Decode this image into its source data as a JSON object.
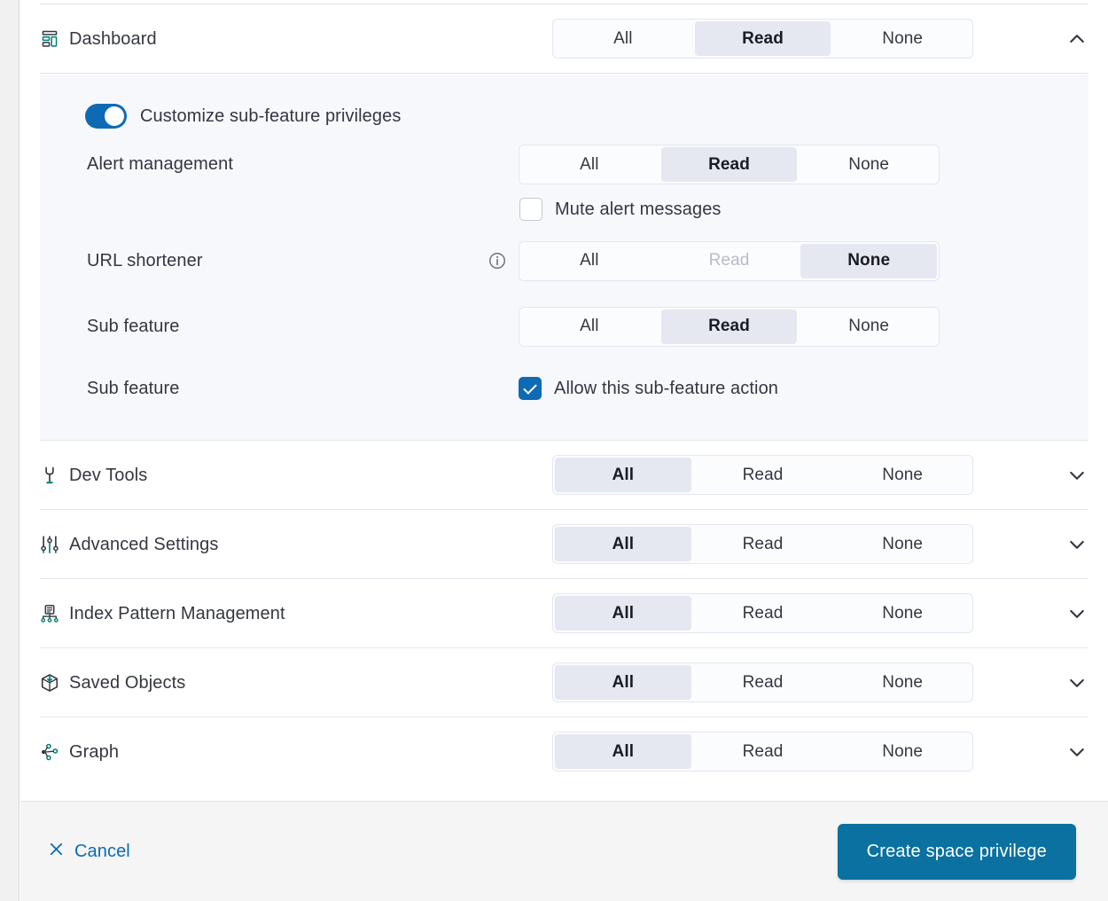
{
  "privilege_options": [
    "All",
    "Read",
    "None"
  ],
  "expanded_feature": {
    "name": "Dashboard",
    "icon": "dashboard-icon",
    "privilege": "Read",
    "expanded": true,
    "collapse_icon": "chevron-up-icon",
    "customize_toggle": {
      "label": "Customize sub-feature privileges",
      "enabled": true
    },
    "sub_features": [
      {
        "label": "Alert management",
        "type": "segmented",
        "selected": "Read",
        "disabled_options": [],
        "info_icon": false,
        "checkbox": {
          "label": "Mute alert messages",
          "checked": false
        }
      },
      {
        "label": "URL shortener",
        "type": "segmented",
        "selected": "None",
        "disabled_options": [
          "Read"
        ],
        "info_icon": true,
        "info_icon_name": "info-icon"
      },
      {
        "label": "Sub feature",
        "type": "segmented",
        "selected": "Read",
        "disabled_options": [],
        "info_icon": false
      },
      {
        "label": "Sub feature",
        "type": "checkbox",
        "checkbox": {
          "label": "Allow this sub-feature action",
          "checked": true
        }
      }
    ]
  },
  "features": [
    {
      "name": "Dev Tools",
      "icon": "wrench-icon",
      "privilege": "All",
      "expanded": false,
      "expand_icon": "chevron-down-icon"
    },
    {
      "name": "Advanced Settings",
      "icon": "controls-icon",
      "privilege": "All",
      "expanded": false,
      "expand_icon": "chevron-down-icon"
    },
    {
      "name": "Index Pattern Management",
      "icon": "index-pattern-icon",
      "privilege": "All",
      "expanded": false,
      "expand_icon": "chevron-down-icon"
    },
    {
      "name": "Saved Objects",
      "icon": "saved-objects-icon",
      "privilege": "All",
      "expanded": false,
      "expand_icon": "chevron-down-icon"
    },
    {
      "name": "Graph",
      "icon": "graph-icon",
      "privilege": "All",
      "expanded": false,
      "expand_icon": "chevron-down-icon"
    }
  ],
  "footer": {
    "cancel_label": "Cancel",
    "cancel_icon": "close-icon",
    "submit_label": "Create space privilege"
  },
  "colors": {
    "accent_blue": "#0a71a0",
    "link_blue": "#0a6bb3",
    "toggle_blue": "#0f6ab4",
    "selected_segment": "#e5e7f1",
    "icon_teal": "#017d73",
    "icon_dark": "#343741",
    "panel_bg": "#f7f8fc",
    "footer_bg": "#f5f5f5",
    "divider": "#e3e6ef"
  }
}
